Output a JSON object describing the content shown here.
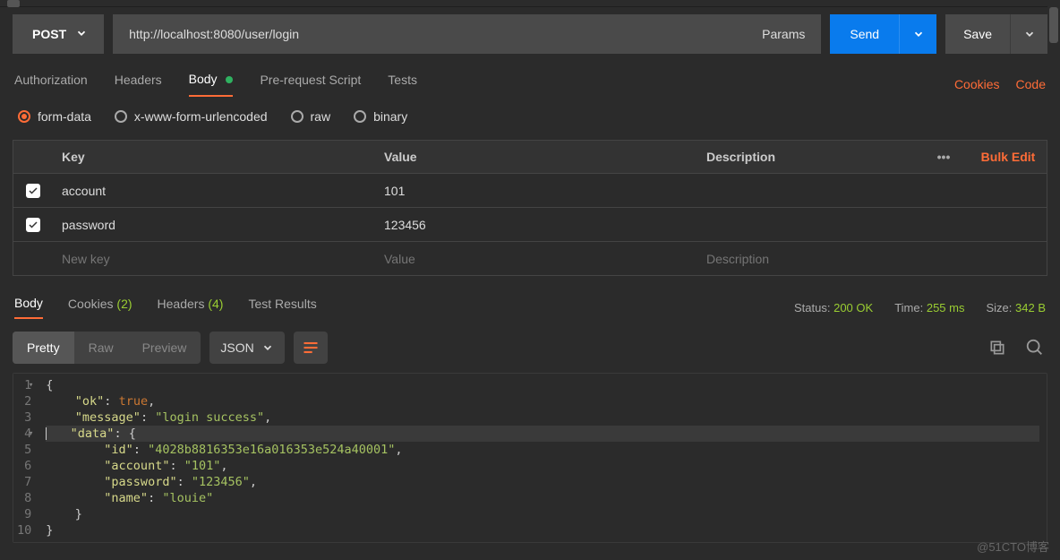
{
  "request": {
    "method": "POST",
    "url": "http://localhost:8080/user/login",
    "params_label": "Params",
    "send_label": "Send",
    "save_label": "Save"
  },
  "req_tabs": {
    "authorization": "Authorization",
    "headers": "Headers",
    "body": "Body",
    "prereq": "Pre-request Script",
    "tests": "Tests",
    "cookies_link": "Cookies",
    "code_link": "Code"
  },
  "body_types": {
    "formdata": "form-data",
    "xwww": "x-www-form-urlencoded",
    "raw": "raw",
    "binary": "binary"
  },
  "kv": {
    "head_key": "Key",
    "head_value": "Value",
    "head_desc": "Description",
    "bulk_edit": "Bulk Edit",
    "rows": [
      {
        "key": "account",
        "value": "101"
      },
      {
        "key": "password",
        "value": "123456"
      }
    ],
    "ph_key": "New key",
    "ph_value": "Value",
    "ph_desc": "Description"
  },
  "resp_tabs": {
    "body": "Body",
    "cookies": "Cookies",
    "cookies_n": "(2)",
    "headers": "Headers",
    "headers_n": "(4)",
    "tests": "Test Results"
  },
  "resp_meta": {
    "status_k": "Status:",
    "status_v": "200 OK",
    "time_k": "Time:",
    "time_v": "255 ms",
    "size_k": "Size:",
    "size_v": "342 B"
  },
  "viewer": {
    "pretty": "Pretty",
    "raw": "Raw",
    "preview": "Preview",
    "json": "JSON"
  },
  "json": {
    "l1": "{",
    "l2a": "\"ok\"",
    "l2b": ": ",
    "l2c": "true",
    "l2d": ",",
    "l3a": "\"message\"",
    "l3b": ": ",
    "l3c": "\"login success\"",
    "l3d": ",",
    "l4a": "\"data\"",
    "l4b": ": {",
    "l5a": "\"id\"",
    "l5b": ": ",
    "l5c": "\"4028b8816353e16a016353e524a40001\"",
    "l5d": ",",
    "l6a": "\"account\"",
    "l6b": ": ",
    "l6c": "\"101\"",
    "l6d": ",",
    "l7a": "\"password\"",
    "l7b": ": ",
    "l7c": "\"123456\"",
    "l7d": ",",
    "l8a": "\"name\"",
    "l8b": ": ",
    "l8c": "\"louie\"",
    "l9": "}",
    "l10": "}"
  },
  "watermark": "@51CTO博客"
}
